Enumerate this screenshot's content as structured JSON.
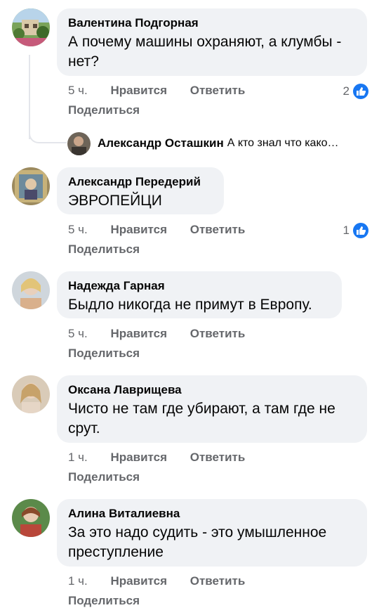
{
  "labels": {
    "like": "Нравится",
    "reply": "Ответить",
    "share": "Поделиться"
  },
  "comments": [
    {
      "author": "Валентина Подгорная",
      "text": "А почему машины охраняют, а клумбы - нет?",
      "time": "5 ч.",
      "likes": "2"
    },
    {
      "author": "Александр Передерий",
      "text": "ЭВРОПЕЙЦИ",
      "time": "5 ч.",
      "likes": "1"
    },
    {
      "author": "Надежда Гарная",
      "text": "Быдло никогда не примут в Европу.",
      "time": "5 ч.",
      "likes": ""
    },
    {
      "author": "Оксана Лаврищева",
      "text": "Чисто не там где убирают, а там где не срут.",
      "time": "1 ч.",
      "likes": ""
    },
    {
      "author": "Алина Виталиевна",
      "text": "За это надо судить - это умышленное преступление",
      "time": "1 ч.",
      "likes": ""
    }
  ],
  "reply": {
    "author": "Александр Осташкин",
    "text": "А кто знал что како…"
  },
  "colors": {
    "like_blue": "#1877f2",
    "bubble": "#f0f2f5",
    "meta": "#65676b"
  }
}
